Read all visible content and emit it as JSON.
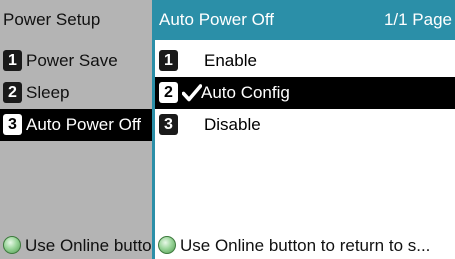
{
  "left_panel": {
    "title": "Power Setup",
    "items": [
      {
        "number": "1",
        "label": "Power Save"
      },
      {
        "number": "2",
        "label": "Sleep"
      },
      {
        "number": "3",
        "label": "Auto Power Off"
      }
    ],
    "footer": "Use Online button to return to standby."
  },
  "right_panel": {
    "title": "Auto Power Off",
    "page_indicator": "1/1 Page",
    "options": [
      {
        "number": "1",
        "label": "Enable",
        "selected": false
      },
      {
        "number": "2",
        "label": "Auto Config",
        "selected": true
      },
      {
        "number": "3",
        "label": "Disable",
        "selected": false
      }
    ],
    "footer": "Use Online button to return to s..."
  },
  "icons": {
    "selected_mark": "checkmark-icon",
    "online_button": "online-button-icon"
  },
  "colors": {
    "accent": "#2b8fa8",
    "highlight_bg": "#000000",
    "highlight_text": "#ffffff"
  }
}
